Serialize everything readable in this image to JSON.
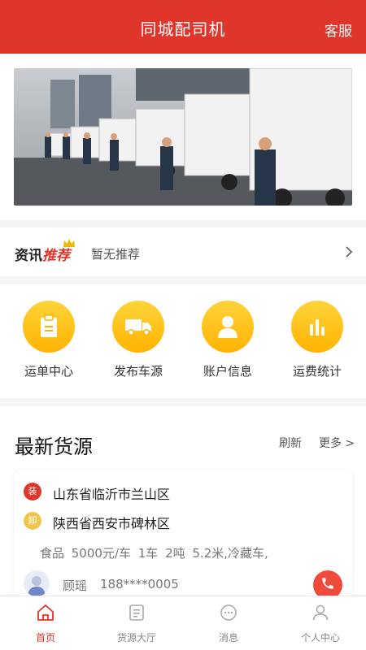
{
  "header": {
    "title": "同城配司机",
    "service_label": "客服"
  },
  "news": {
    "logo_main": "资讯",
    "logo_highlight": "推荐",
    "text": "暂无推荐"
  },
  "quick_actions": [
    {
      "label": "运单中心",
      "icon": "clipboard-icon"
    },
    {
      "label": "发布车源",
      "icon": "truck-icon"
    },
    {
      "label": "账户信息",
      "icon": "user-icon"
    },
    {
      "label": "运费统计",
      "icon": "bar-chart-icon"
    }
  ],
  "latest": {
    "title": "最新货源",
    "refresh_label": "刷新",
    "more_label": "更多 >"
  },
  "cargo": {
    "load_badge": "装",
    "load_address": "山东省临沂市兰山区",
    "unload_badge": "卸",
    "unload_address": "陕西省西安市碑林区",
    "details": "食品  5000元/车  1车  2吨  5.2米,冷藏车,",
    "contact_name": "顾瑶",
    "contact_phone": "188****0005"
  },
  "tabs": [
    {
      "label": "首页",
      "active": true
    },
    {
      "label": "货源大厅",
      "active": false
    },
    {
      "label": "消息",
      "active": false
    },
    {
      "label": "个人中心",
      "active": false
    }
  ],
  "colors": {
    "brand": "#e0352b",
    "accent": "#ffc107"
  }
}
